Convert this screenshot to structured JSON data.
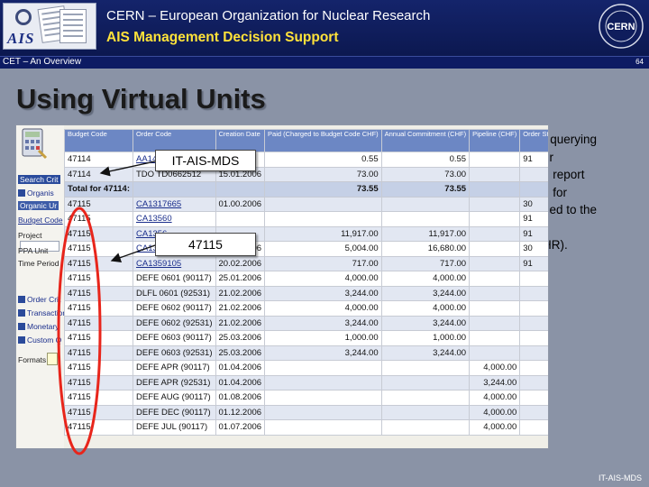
{
  "header": {
    "org_title": "CERN – European Organization for Nuclear Research",
    "subtitle": "AIS Management Decision Support",
    "logo_text": "AIS",
    "cern_logo_text": "CERN"
  },
  "subbar": {
    "title": "CET – An Overview",
    "page_number": "64"
  },
  "slide": {
    "title": "Using Virtual Units",
    "right_text_lines": [
      "r querying",
      "or",
      "e report",
      "n for",
      "ged to the",
      "",
      "HR)."
    ],
    "footer": "IT-AIS-MDS"
  },
  "callouts": {
    "mds": "IT-AIS-MDS",
    "unit": "47115"
  },
  "sidebar": {
    "items": [
      "Search Crit",
      "Organis",
      "Organic Ur",
      "Budget Code",
      "Project",
      "PPA Unit",
      "Time Period",
      "Order Crit",
      "Transaction",
      "Monetary",
      "Custom Q",
      "Formats"
    ]
  },
  "table": {
    "columns": [
      "Budget Code",
      "Order Code",
      "Creation Date",
      "Paid (Charged to Budget Code CHF)",
      "Annual Commitment (CHF)",
      "Pipeline (CHF)",
      "Order Status"
    ],
    "rows": [
      {
        "budget": "47114",
        "order": "AA1414",
        "date": "",
        "paid": "0.55",
        "annual": "0.55",
        "pipeline": "",
        "status": "91",
        "order_link": true
      },
      {
        "budget": "47114",
        "order": "TDO TD0662512",
        "date": "15.01.2006",
        "paid": "73.00",
        "annual": "73.00",
        "pipeline": "",
        "status": "",
        "order_link": false
      },
      {
        "budget": "Total for 47114:",
        "order": "",
        "date": "",
        "paid": "73.55",
        "annual": "73.55",
        "pipeline": "",
        "status": "",
        "subtotal": true
      },
      {
        "budget": "47115",
        "order": "CA1317665",
        "date": "01.00.2006",
        "paid": "",
        "annual": "",
        "pipeline": "",
        "status": "30",
        "order_link": true
      },
      {
        "budget": "47115",
        "order": "CA13560",
        "date": "",
        "paid": "",
        "annual": "",
        "pipeline": "",
        "status": "91",
        "order_link": true
      },
      {
        "budget": "47115",
        "order": "CA1356",
        "date": "",
        "paid": "11,917.00",
        "annual": "11,917.00",
        "pipeline": "",
        "status": "91",
        "order_link": true
      },
      {
        "budget": "47115",
        "order": "CA1358009",
        "date": "06.02.2006",
        "paid": "5,004.00",
        "annual": "16,680.00",
        "pipeline": "",
        "status": "30",
        "order_link": true
      },
      {
        "budget": "47115",
        "order": "CA1359105",
        "date": "20.02.2006",
        "paid": "717.00",
        "annual": "717.00",
        "pipeline": "",
        "status": "91",
        "order_link": true
      },
      {
        "budget": "47115",
        "order": "DEFE 0601 (90117)",
        "date": "25.01.2006",
        "paid": "4,000.00",
        "annual": "4,000.00",
        "pipeline": "",
        "status": "",
        "order_link": false
      },
      {
        "budget": "47115",
        "order": "DLFL 0601 (92531)",
        "date": "21.02.2006",
        "paid": "3,244.00",
        "annual": "3,244.00",
        "pipeline": "",
        "status": "",
        "order_link": false
      },
      {
        "budget": "47115",
        "order": "DEFE 0602 (90117)",
        "date": "21.02.2006",
        "paid": "4,000.00",
        "annual": "4,000.00",
        "pipeline": "",
        "status": "",
        "order_link": false
      },
      {
        "budget": "47115",
        "order": "DEFE 0602 (92531)",
        "date": "21.02.2006",
        "paid": "3,244.00",
        "annual": "3,244.00",
        "pipeline": "",
        "status": "",
        "order_link": false
      },
      {
        "budget": "47115",
        "order": "DEFE 0603 (90117)",
        "date": "25.03.2006",
        "paid": "1,000.00",
        "annual": "1,000.00",
        "pipeline": "",
        "status": "",
        "order_link": false
      },
      {
        "budget": "47115",
        "order": "DEFE 0603 (92531)",
        "date": "25.03.2006",
        "paid": "3,244.00",
        "annual": "3,244.00",
        "pipeline": "",
        "status": "",
        "order_link": false
      },
      {
        "budget": "47115",
        "order": "DEFE APR (90117)",
        "date": "01.04.2006",
        "paid": "",
        "annual": "",
        "pipeline": "4,000.00",
        "status": "",
        "order_link": false
      },
      {
        "budget": "47115",
        "order": "DEFE APR (92531)",
        "date": "01.04.2006",
        "paid": "",
        "annual": "",
        "pipeline": "3,244.00",
        "status": "",
        "order_link": false
      },
      {
        "budget": "47115",
        "order": "DEFE AUG (90117)",
        "date": "01.08.2006",
        "paid": "",
        "annual": "",
        "pipeline": "4,000.00",
        "status": "",
        "order_link": false
      },
      {
        "budget": "47115",
        "order": "DEFE DEC (90117)",
        "date": "01.12.2006",
        "paid": "",
        "annual": "",
        "pipeline": "4,000.00",
        "status": "",
        "order_link": false
      },
      {
        "budget": "47115",
        "order": "DEFE JUL (90117)",
        "date": "01.07.2006",
        "paid": "",
        "annual": "",
        "pipeline": "4,000.00",
        "status": "",
        "order_link": false
      }
    ]
  },
  "colors": {
    "header_bg": "#14246b",
    "subtitle_yellow": "#ffe23a",
    "table_header": "#6c87c4",
    "annotation_red": "#e8251b"
  }
}
